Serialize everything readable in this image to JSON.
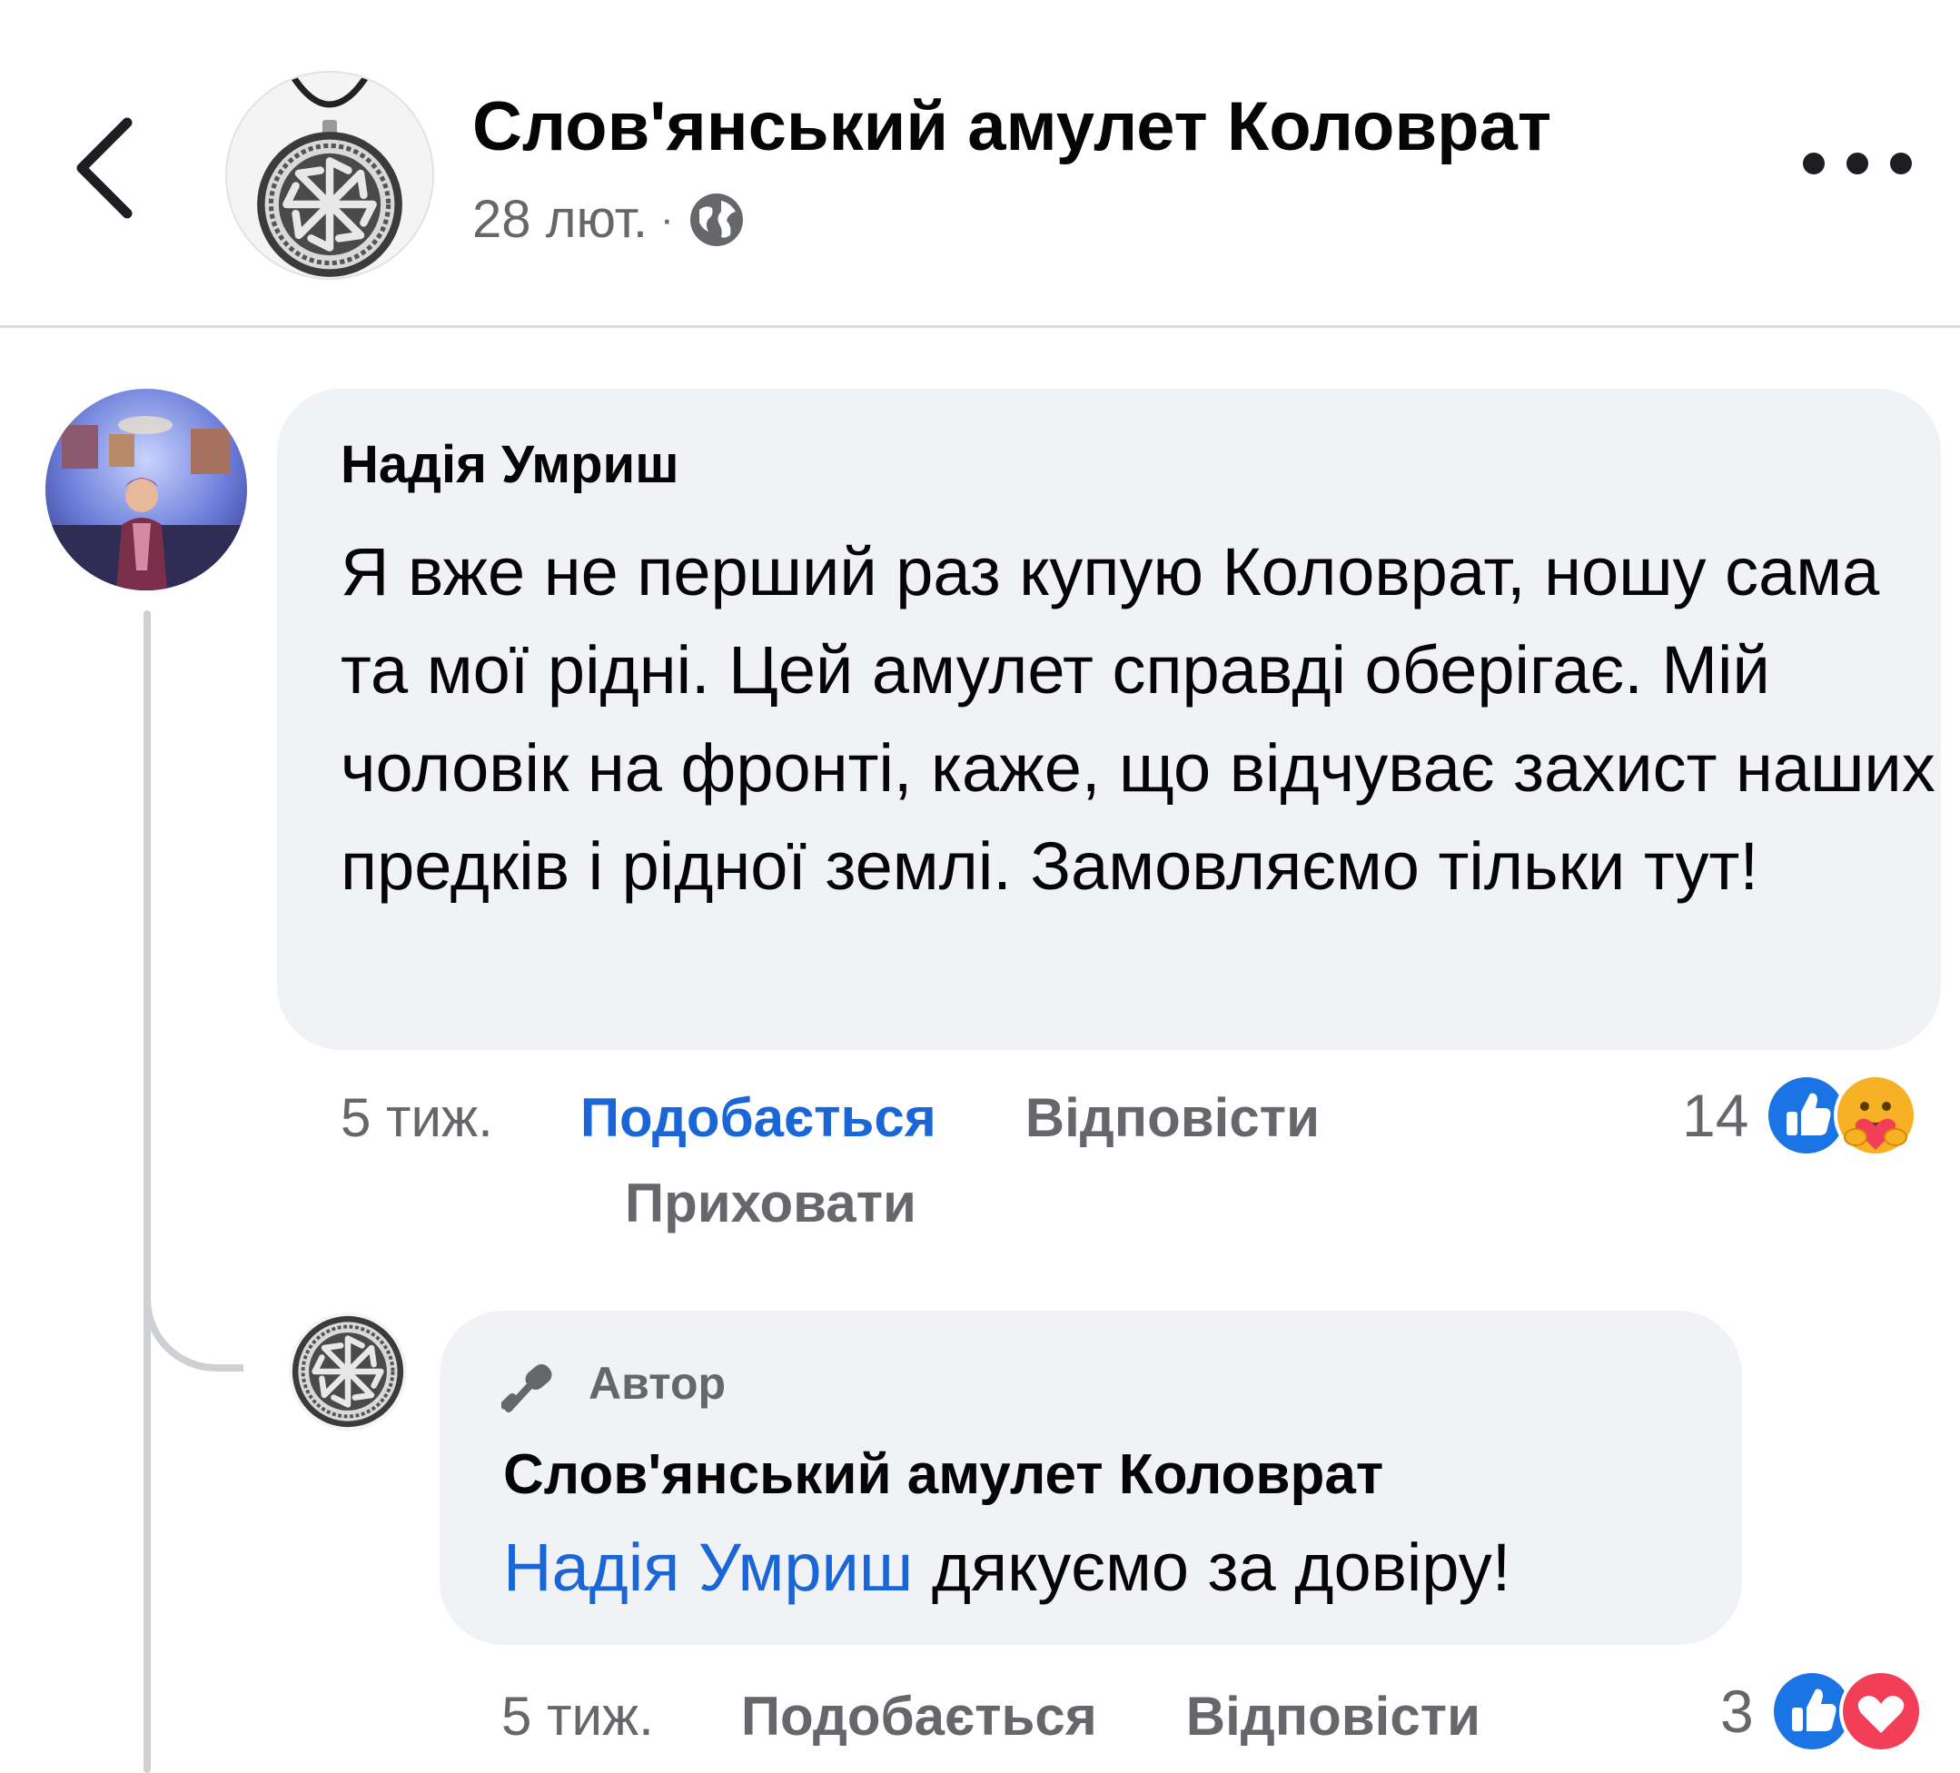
{
  "header": {
    "title": "Слов'янський амулет Коловрат",
    "date": "28 лют.",
    "separator": "·",
    "audience_icon": "globe-icon",
    "back_icon": "chevron-left-icon",
    "more_icon": "more-dots-icon"
  },
  "comment": {
    "author": "Надія Умриш",
    "text": "Я вже не перший раз купую Коловрат, ношу сама та мої рідні. Цей амулет справді оберігає. Мій чоловік на фронті, каже, що відчуває захист наших предків і рідної землі. Замовляємо тільки тут!",
    "time": "5 тиж.",
    "like_label": "Подобається",
    "reply_label": "Відповісти",
    "hide_label": "Приховати",
    "reaction_count": "14",
    "reactions": [
      "like-reaction-icon",
      "care-reaction-icon"
    ]
  },
  "reply": {
    "badge_icon": "microphone-icon",
    "badge": "Автор",
    "author": "Слов'янський амулет Коловрат",
    "mention": "Надія Умриш",
    "text": "дякуємо за довіру!",
    "time": "5 тиж.",
    "like_label": "Подобається",
    "reply_label": "Відповісти",
    "reaction_count": "3",
    "reactions": [
      "like-reaction-icon",
      "love-reaction-icon"
    ]
  },
  "colors": {
    "accent": "#1b66d6",
    "secondary_text": "#65676b",
    "bubble": "#f0f2f5",
    "thread_line": "#ced0d4"
  }
}
